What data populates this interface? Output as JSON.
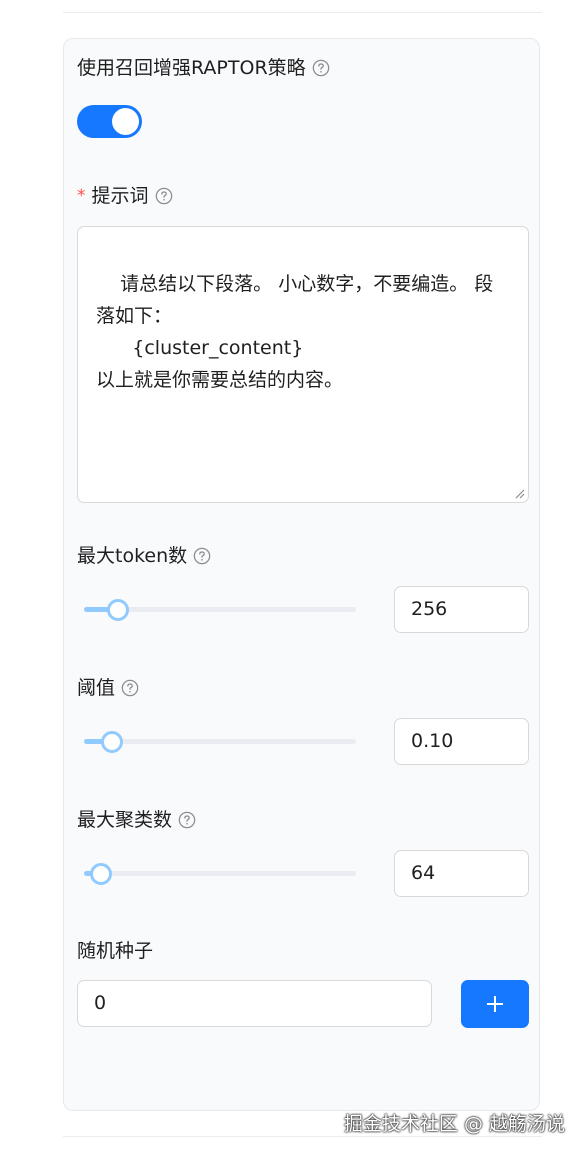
{
  "raptor": {
    "label": "使用召回增强RAPTOR策略",
    "enabled": true
  },
  "prompt": {
    "required_mark": "*",
    "label": "提示词",
    "value": "请总结以下段落。 小心数字，不要编造。 段落如下：\n      {cluster_content}\n以上就是你需要总结的内容。"
  },
  "max_token": {
    "label": "最大token数",
    "value": "256",
    "fraction": 0.12
  },
  "threshold": {
    "label": "阈值",
    "value": "0.10",
    "fraction": 0.1
  },
  "max_cluster": {
    "label": "最大聚类数",
    "value": "64",
    "fraction": 0.06
  },
  "random_seed": {
    "label": "随机种子",
    "value": "0",
    "add_icon": "plus-icon"
  },
  "watermark": "掘金技术社区 @ 越觞汤说",
  "colors": {
    "primary": "#1677ff",
    "slider_track": "#91caff",
    "required": "#ff4d4f",
    "panel_bg": "#f9fafc"
  }
}
